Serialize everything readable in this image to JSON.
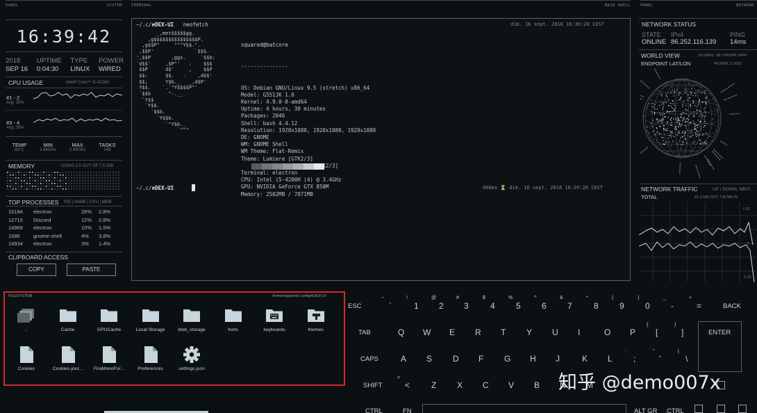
{
  "headers": {
    "panel_left": "PANEL",
    "system": "SYSTEM",
    "terminal": "TERMINAL",
    "main_shell": "MAIN SHELL",
    "panel_right": "PANEL",
    "network": "NETWORK",
    "filesystem": "FILESYSTEM",
    "fs_path": "/home/squared/.config/eDEX-UI"
  },
  "clock": "16:39:42",
  "sysinfo": [
    {
      "label": "2018",
      "value": "SEP 16"
    },
    {
      "label": "UPTIME",
      "value": "0:04:30"
    },
    {
      "label": "TYPE",
      "value": "LINUX"
    },
    {
      "label": "POWER",
      "value": "WIRED"
    }
  ],
  "cpu": {
    "title": "CPU USAGE",
    "model": "Intel® Core™ i5-4200H",
    "cores": [
      {
        "label": "#1 - 2",
        "avg": "Avg. 35%"
      },
      {
        "label": "#3 - 4",
        "avg": "Avg. 35%"
      }
    ],
    "stats": [
      {
        "label": "TEMP",
        "value": "68°C"
      },
      {
        "label": "MIN",
        "value": "2.84GHz"
      },
      {
        "label": "MAX",
        "value": "2.99GHz"
      },
      {
        "label": "TASKS",
        "value": "248"
      }
    ]
  },
  "memory": {
    "title": "MEMORY",
    "usage": "USING 1.5 OUT OF 7.5 GIB"
  },
  "processes": {
    "title": "TOP PROCESSES",
    "columns": "PID | NAME | CPU | MEM",
    "rows": [
      {
        "pid": "15184",
        "name": "electron",
        "cpu": "26%",
        "mem": "2.8%"
      },
      {
        "pid": "12715",
        "name": "Discord",
        "cpu": "12%",
        "mem": "2.8%"
      },
      {
        "pid": "14969",
        "name": "electron",
        "cpu": "10%",
        "mem": "1.5%"
      },
      {
        "pid": "1586",
        "name": "gnome-shell",
        "cpu": "4%",
        "mem": "3.8%"
      },
      {
        "pid": "14934",
        "name": "electron",
        "cpu": "3%",
        "mem": "1.4%"
      }
    ]
  },
  "clipboard": {
    "title": "CLIPBOARD ACCESS",
    "copy": "COPY",
    "paste": "PASTE"
  },
  "terminal": {
    "prompt1_path": "~/.c/",
    "prompt1_app": "eDEX-UI",
    "prompt1_cmd": "neofetch",
    "time1": "dim. 16 sept. 2018 16:39:20 CEST",
    "ascii": "       _,met$$$$$gg.\n    ,g$$$$$$$$$$$$$$$P.\n  ,g$$P\"     \"\"\"Y$$.\".\n ,$$P'              `$$$.\n',$$P       ,ggs.     `$$b:\n`d$$'     ,$P\"'   .    $$$\n $$P      d$'     ,    $$P\n $$:      $$.   -    ,d$$'\n $$;      Y$b._   _,d$P'\n Y$$.    `.`\"Y$$$$P\"'\n `$$b      \"-.__\n  `Y$$\n   `Y$$.\n     `$$b.\n       `Y$$b.\n          `\"Y$b._\n              `\"\"\"",
    "user": "squared@batcore",
    "sep": "---------------",
    "info": [
      "OS: Debian GNU/Linux 9.5 (stretch) x86_64",
      "Model: G551JK 1.0",
      "Kernel: 4.9.0-8-amd64",
      "Uptime: 4 hours, 30 minutes",
      "Packages: 2046",
      "Shell: bash 4.4.12",
      "Resolution: 1920x1080, 1920x1080, 1920x1080",
      "DE: GNOME",
      "WM: GNOME Shell",
      "WM Theme: Flat-Remix",
      "Theme: Lumiere [GTK2/3]",
      "Icons: Flat-Remix-Dark [GTK2/3]",
      "Terminal: electron",
      "CPU: Intel i5-4200H (4) @ 3.4GHz",
      "GPU: NVIDIA GeForce GTX 850M",
      "Memory: 2502MB / 7871MB"
    ],
    "prompt2_path": "~/.c/",
    "prompt2_app": "eDEX-UI",
    "time2": "860ms ⏳ dim. 16 sept. 2018 16:39:26 CEST"
  },
  "network": {
    "status_title": "NETWORK STATUS",
    "state_label": "STATE",
    "state_value": "ONLINE",
    "ip_label": "IPv4",
    "ip_value": "86.252.116.139",
    "ping_label": "PING",
    "ping_value": "14ms",
    "world_title": "WORLD VIEW",
    "world_sub": "GLOBAL NETWORK MAP",
    "endpoint": "ENDPOINT LAT/LON",
    "endpoint_value": "48.8488, 2.3663",
    "traffic_title": "NETWORK TRAFFIC",
    "traffic_sub": "UP / DOWN, MB/S",
    "total": "TOTAL",
    "total_value": "82.3 MB OUT, 738 MB IN"
  },
  "files": [
    {
      "name": "..",
      "type": "up"
    },
    {
      "name": "Cache",
      "type": "folder"
    },
    {
      "name": "GPUCache",
      "type": "folder"
    },
    {
      "name": "Local Storage",
      "type": "folder"
    },
    {
      "name": "blob_storage",
      "type": "folder"
    },
    {
      "name": "fonts",
      "type": "folder"
    },
    {
      "name": "keyboards",
      "type": "keyboard"
    },
    {
      "name": "themes",
      "type": "theme"
    },
    {
      "name": "Cookies",
      "type": "file"
    },
    {
      "name": "Cookies-jour...",
      "type": "file"
    },
    {
      "name": "FiraMonoFor...",
      "type": "file"
    },
    {
      "name": "Preferences",
      "type": "file"
    },
    {
      "name": "settings.json",
      "type": "settings"
    }
  ],
  "keyboard": {
    "esc": "ESC",
    "back": "BACK",
    "tab": "TAB",
    "enter": "ENTER",
    "caps": "CAPS",
    "shift": "SHIFT",
    "ctrl": "CTRL",
    "fn": "FN",
    "altgr": "ALT GR",
    "ctrl2": "CTRL",
    "row1": [
      {
        "k": "`",
        "s": "~"
      },
      {
        "k": "1",
        "s": "!"
      },
      {
        "k": "2",
        "s": "@"
      },
      {
        "k": "3",
        "s": "#"
      },
      {
        "k": "4",
        "s": "$"
      },
      {
        "k": "5",
        "s": "%"
      },
      {
        "k": "6",
        "s": "^"
      },
      {
        "k": "7",
        "s": "&"
      },
      {
        "k": "8",
        "s": "*"
      },
      {
        "k": "9",
        "s": "("
      },
      {
        "k": "0",
        "s": ")"
      },
      {
        "k": "-",
        "s": "_"
      },
      {
        "k": "=",
        "s": "+"
      }
    ],
    "row2": [
      "Q",
      "W",
      "E",
      "R",
      "T",
      "Y",
      "U",
      "I",
      "O",
      "P",
      "[",
      "]"
    ],
    "row2_sup": [
      "{",
      "}"
    ],
    "row3": [
      "A",
      "S",
      "D",
      "F",
      "G",
      "H",
      "J",
      "K",
      "L",
      ";",
      "'",
      "\\"
    ],
    "row3_sup": [
      ":",
      "\"",
      "|"
    ],
    "row4": [
      "<",
      "Z",
      "X",
      "C",
      "V",
      "B",
      "N",
      "M"
    ],
    "row4_sup": [
      ">"
    ]
  },
  "watermark": "知乎 @demo007x"
}
